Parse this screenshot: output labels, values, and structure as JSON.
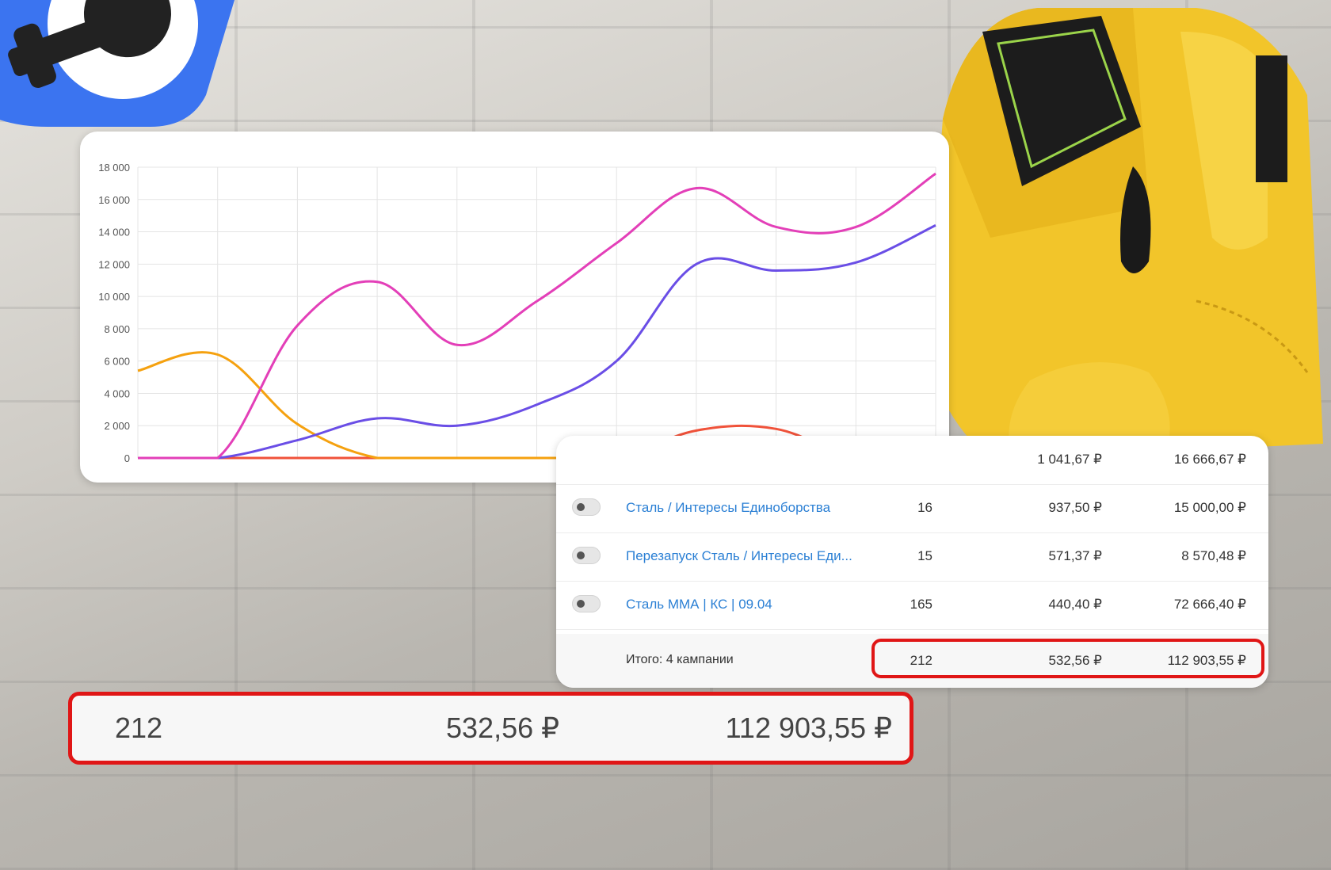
{
  "chart_data": {
    "type": "line",
    "y_ticks": [
      "18 000",
      "16 000",
      "14 000",
      "12 000",
      "10 000",
      "8 000",
      "6 000",
      "4 000",
      "2 000",
      "0"
    ],
    "ylim": [
      0,
      18000
    ],
    "x": [
      0,
      1,
      2,
      3,
      4,
      5,
      6,
      7,
      8,
      9,
      10
    ],
    "series": [
      {
        "color": "#e33fb8",
        "values": [
          0,
          0,
          8200,
          10900,
          7000,
          9700,
          13300,
          16700,
          14300,
          14300,
          17600
        ]
      },
      {
        "color": "#6a4ee6",
        "values": [
          0,
          0,
          1100,
          2450,
          2000,
          3300,
          6000,
          12000,
          11600,
          12100,
          14400
        ]
      },
      {
        "color": "#f5a10f",
        "values": [
          5400,
          6400,
          2100,
          0,
          0,
          0,
          0,
          0,
          0,
          0,
          0
        ]
      },
      {
        "color": "#f0523a",
        "values": [
          0,
          0,
          0,
          0,
          0,
          0,
          0,
          1700,
          1800,
          0,
          0
        ]
      }
    ],
    "grid": true
  },
  "table": {
    "top_row": {
      "avg": "1 041,67 ₽",
      "sum": "16 666,67 ₽"
    },
    "rows": [
      {
        "name": "Сталь / Интересы Единоборства",
        "count": "16",
        "avg": "937,50 ₽",
        "sum": "15 000,00 ₽"
      },
      {
        "name": "Перезапуск Сталь / Интересы Еди...",
        "count": "15",
        "avg": "571,37 ₽",
        "sum": "8 570,48 ₽"
      },
      {
        "name": "Сталь ММА | КС | 09.04",
        "count": "165",
        "avg": "440,40 ₽",
        "sum": "72 666,40 ₽"
      }
    ],
    "total": {
      "label": "Итого: 4 кампании",
      "count": "212",
      "avg": "532,56 ₽",
      "sum": "112 903,55 ₽"
    }
  },
  "highlight": {
    "count": "212",
    "avg": "532,56 ₽",
    "sum": "112 903,55 ₽"
  },
  "colors": {
    "accent_red": "#e01616",
    "logo_blue": "#3b74f0",
    "glove_yellow": "#f2c52a",
    "link_blue": "#2a7fd4"
  }
}
